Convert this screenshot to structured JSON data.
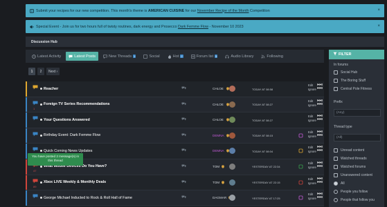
{
  "notices": {
    "competition": {
      "prefix": "Submit your recipes for our new competition. This month's theme is",
      "theme": "AMERICAN CUISINE",
      "mid": "for our",
      "link": "November Recipe of the Month",
      "suffix": "Competition",
      "close": "×"
    },
    "event": {
      "prefix": "Special Event - Join us for two hours full of twisty routines, dark energy and Prosecco",
      "link": "Dark Femme Flow",
      "suffix": "- November 10 2023",
      "close": "×"
    }
  },
  "breadcrumb": "Discussion Hub",
  "tabs": [
    {
      "label": "Latest Activity",
      "icon": "clock-icon"
    },
    {
      "label": "Latest Posts",
      "icon": "chat-icon",
      "active": true
    },
    {
      "label": "New Threads",
      "icon": "comment-icon",
      "count": "1"
    },
    {
      "label": "Social",
      "icon": "users-icon"
    },
    {
      "label": "Hot",
      "icon": "fire-icon",
      "count": "2"
    },
    {
      "label": "Forum list",
      "icon": "list-icon",
      "count": "5"
    },
    {
      "label": "Audio Library",
      "icon": "headphones-icon"
    },
    {
      "label": "Following",
      "icon": "rss-icon"
    }
  ],
  "pagination": {
    "pages": [
      "1",
      "2"
    ],
    "next": "Next ›"
  },
  "threads": [
    {
      "title": "Reacher",
      "bold": true,
      "author": "CHLOE",
      "date": "TODAY AT 08:58",
      "stripe": "#e0a830",
      "count": "",
      "author_color": "#d0d5da"
    },
    {
      "title": "Foreign TV Series Recommendations",
      "bold": true,
      "author": "CHLOE",
      "date": "TODAY AT 08:27",
      "stripe": "#3a85c5",
      "count": "1",
      "author_color": "#d0d5da"
    },
    {
      "title": "Your Questions Answered",
      "bold": true,
      "author": "CHLOE",
      "date": "TODAY AT 08:27",
      "stripe": "#3a85c5",
      "count": "",
      "author_color": "#d0d5da"
    },
    {
      "title": "Birthday Event: Dark Femme Flow",
      "bold": false,
      "author": "DEMNA",
      "date": "TODAY AT 08:15",
      "stripe": "#3a85c5",
      "count": "",
      "author_color": "#c25bd6"
    },
    {
      "title": "Quick Coming News Updates",
      "bold": false,
      "author": "DEMNA",
      "date": "TODAY AT 08:04",
      "stripe": "#3a85c5",
      "count": "",
      "author_color": "#c25bd6"
    },
    {
      "title": "What Mobile Devices Do You Have?",
      "bold": true,
      "author": "TOM",
      "date": "YESTERDAY AT 22:34",
      "stripe": "#d1453b",
      "count": "47",
      "author_color": "#d0d5da"
    },
    {
      "title": "Xbox LIVE Weekly & Monthly Deals",
      "bold": true,
      "author": "TOM",
      "date": "YESTERDAY AT 22:15",
      "stripe": "#d1453b",
      "count": "89",
      "author_color": "#d0d5da"
    },
    {
      "title": "George Michael Inducted to Rock & Roll Hall of Fame",
      "bold": false,
      "author": "DAGMAR",
      "date": "YESTERDAY AT 17:25",
      "stripe": "#3a85c5",
      "count": "",
      "author_color": "#d0d5da"
    }
  ],
  "row_actions": {
    "edit": "Edit",
    "ignore": "Ignore"
  },
  "toast": "You have posted 2 message(s) in this thread",
  "filter": {
    "header": "FILTER",
    "in_forums_label": "In forums",
    "forums": [
      "Social Hub",
      "The Boring Stuff",
      "Central Pole Fitness"
    ],
    "prefix_label": "Prefix",
    "prefix_value": "(Any)",
    "thread_type_label": "Thread type",
    "thread_type_value": "(All)",
    "checks": [
      "Unread content",
      "Watched threads",
      "Watched forums",
      "Unanswered content"
    ],
    "radios": [
      "All",
      "People you follow",
      "People that follow you"
    ]
  },
  "colors": {
    "accent": "#55b3a6",
    "notice": "#4aa9c4",
    "panel": "#2a2f37",
    "background": "#1a1c20"
  }
}
